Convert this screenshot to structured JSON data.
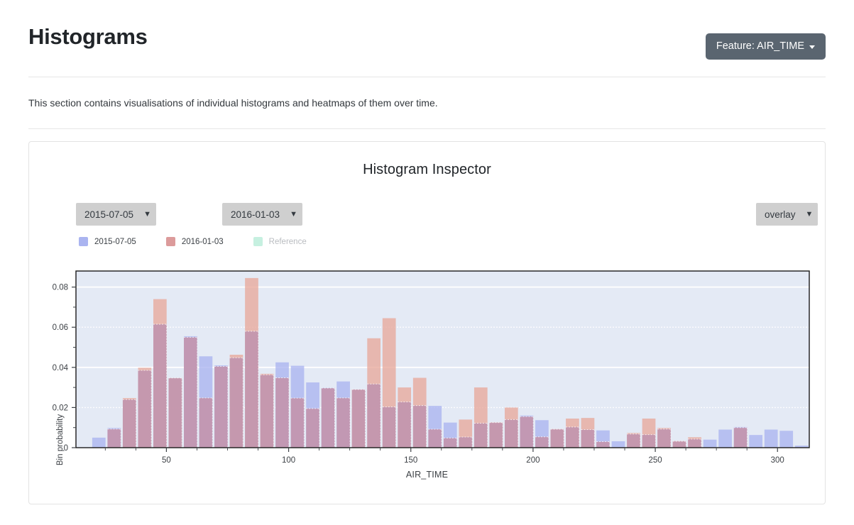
{
  "header": {
    "title": "Histograms",
    "feature_button_label": "Feature: AIR_TIME",
    "feature_caret_icon": "caret-down-icon"
  },
  "section": {
    "description": "This section contains visualisations of individual histograms and heatmaps of them over time."
  },
  "card": {
    "title": "Histogram Inspector",
    "controls": {
      "select_a_value": "2015-07-05",
      "select_b_value": "2016-01-03",
      "mode_value": "overlay",
      "arrow_icon": "triangle-down-icon"
    },
    "legend": [
      {
        "label": "2015-07-05",
        "color": "#aab4f0",
        "muted": false
      },
      {
        "label": "2016-01-03",
        "color": "#dc9b9b",
        "muted": false
      },
      {
        "label": "Reference",
        "color": "#c6f0e0",
        "muted": true
      }
    ]
  },
  "colors": {
    "series_a": "#aab4f0",
    "series_b": "#e8a89b",
    "overlap": "#c295ae",
    "plot_bg": "#e4eaf5",
    "accent_button": "#5a6570",
    "select_bg": "#cfcfcf"
  },
  "chart_data": {
    "type": "bar",
    "title": "Histogram Inspector",
    "xlabel": "AIR_TIME",
    "ylabel": "Bin probability",
    "mode": "overlay",
    "xlim": [
      13,
      313
    ],
    "ylim": [
      0,
      0.088
    ],
    "xticks": [
      50,
      100,
      150,
      200,
      250,
      300
    ],
    "yticks": [
      0,
      0.02,
      0.04,
      0.06,
      0.08
    ],
    "ytick_labels": [
      "0",
      "0.02",
      "0.04",
      "0.06",
      "0.08"
    ],
    "grid": true,
    "legend_position": "top-left",
    "bin_width": 6.25,
    "bin_centers": [
      16,
      22,
      28,
      35,
      41,
      47,
      53,
      60,
      66,
      72,
      78,
      85,
      91,
      97,
      103,
      110,
      116,
      122,
      128,
      135,
      141,
      147,
      153,
      160,
      166,
      172,
      178,
      185,
      191,
      197,
      203,
      210,
      216,
      222,
      228,
      235,
      241,
      247,
      253,
      260,
      266,
      272,
      278,
      285,
      291,
      297,
      303,
      309
    ],
    "series": [
      {
        "name": "2015-07-05",
        "color": "#aab4f0",
        "values": [
          0.0,
          0.005,
          0.0098,
          0.024,
          0.0385,
          0.0615,
          0.0347,
          0.0555,
          0.0455,
          0.041,
          0.0448,
          0.058,
          0.0363,
          0.0425,
          0.0408,
          0.0325,
          0.0298,
          0.033,
          0.029,
          0.0317,
          0.0203,
          0.0228,
          0.021,
          0.0208,
          0.0125,
          0.0053,
          0.0122,
          0.0125,
          0.014,
          0.016,
          0.0137,
          0.0092,
          0.0103,
          0.009,
          0.0086,
          0.0032,
          0.0068,
          0.0065,
          0.0093,
          0.0032,
          0.0043,
          0.004,
          0.009,
          0.0103,
          0.0063,
          0.009,
          0.0084,
          0.001
        ]
      },
      {
        "name": "2016-01-03",
        "color": "#e8a89b",
        "values": [
          0.0,
          0.0,
          0.0093,
          0.0247,
          0.0398,
          0.074,
          0.0347,
          0.055,
          0.0248,
          0.0405,
          0.0463,
          0.0845,
          0.0368,
          0.0348,
          0.0247,
          0.0195,
          0.0297,
          0.0248,
          0.029,
          0.0545,
          0.0645,
          0.03,
          0.0348,
          0.0092,
          0.0048,
          0.014,
          0.03,
          0.0126,
          0.02,
          0.0155,
          0.0054,
          0.0093,
          0.0145,
          0.0148,
          0.003,
          0.0,
          0.0073,
          0.0145,
          0.0098,
          0.0033,
          0.0052,
          0.0,
          0.0,
          0.01,
          0.0,
          0.0,
          0.0,
          0.0
        ]
      }
    ]
  }
}
